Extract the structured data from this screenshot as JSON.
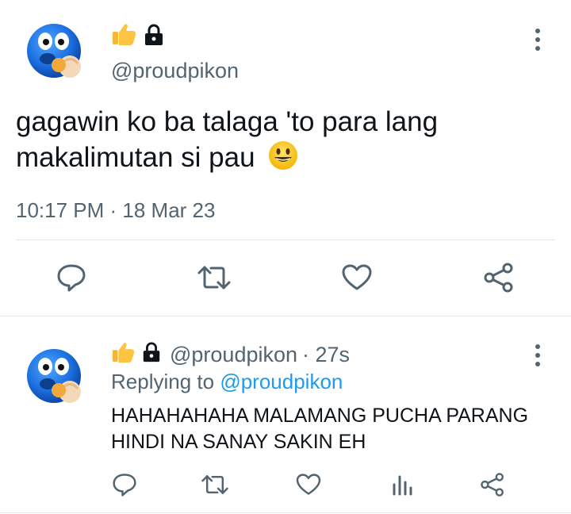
{
  "main_tweet": {
    "avatar": "blue-emoji-avatar",
    "name_badges": [
      "thumbs-up-icon",
      "lock-icon"
    ],
    "handle": "@proudpikon",
    "text": "gagawin ko ba talaga 'to para lang makalimutan si pau",
    "trailing_emoji": "grinning-face-icon",
    "timestamp": "10:17 PM · 18 Mar 23",
    "actions": [
      "reply-icon",
      "retweet-icon",
      "like-icon",
      "share-icon"
    ]
  },
  "reply_tweet": {
    "avatar": "blue-emoji-avatar",
    "name_badges": [
      "thumbs-up-icon",
      "lock-icon"
    ],
    "handle": "@proudpikon",
    "time_ago": "· 27s",
    "replying_label": "Replying to",
    "replying_handle": "@proudpikon",
    "text": "HAHAHAHAHA MALAMANG PUCHA PARANG HINDI NA SANAY SAKIN EH",
    "actions": [
      "reply-icon",
      "retweet-icon",
      "like-icon",
      "views-icon",
      "share-icon"
    ]
  },
  "colors": {
    "text": "#0f1419",
    "secondary": "#536471",
    "link": "#1d9bf0",
    "avatar_blue": "#1b6fe0"
  }
}
